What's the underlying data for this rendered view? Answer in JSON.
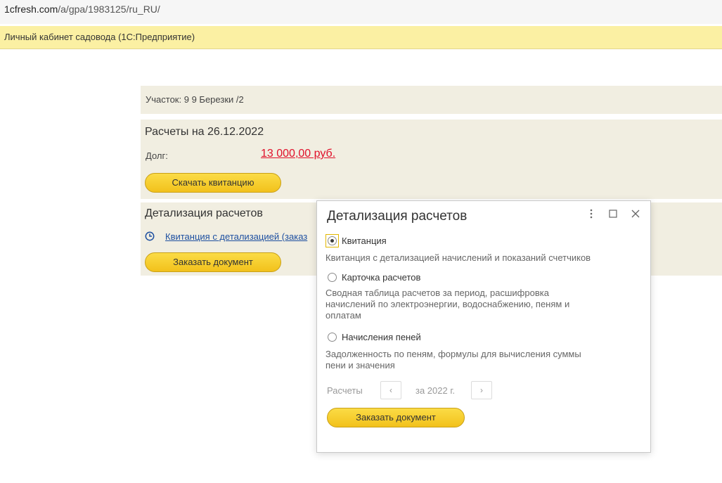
{
  "browser": {
    "url_host": "1cfresh.com",
    "url_path": "/a/gpa/1983125/ru_RU/"
  },
  "app": {
    "title": "Личный кабинет садовода  (1С:Предприятие)"
  },
  "plot": {
    "label": "Участок:",
    "value": "9 9 Березки /2"
  },
  "calculations": {
    "title": "Расчеты на 26.12.2022",
    "debt_label": "Долг:",
    "debt_value": "13 000,00 руб.",
    "download_button": "Скачать квитанцию"
  },
  "detail_section": {
    "title": "Детализация расчетов",
    "link_text": "Квитанция с детализацией (заказ",
    "order_button": "Заказать документ"
  },
  "dialog": {
    "title": "Детализация расчетов",
    "options": [
      {
        "label": "Квитанция",
        "description": "Квитанция с детализацией начислений и показаний счетчиков",
        "selected": true
      },
      {
        "label": "Карточка расчетов",
        "description": "Сводная таблица расчетов за период, расшифровка начислений по электроэнергии, водоснабжению, пеням и оплатам",
        "selected": false
      },
      {
        "label": "Начисления пеней",
        "description": "Задолженность по пеням, формулы для вычисления суммы пени и значения",
        "selected": false
      }
    ],
    "period_label": "Расчеты",
    "period_prev": "‹",
    "period_value": "за 2022 г.",
    "period_next": "›",
    "order_button": "Заказать документ"
  },
  "colors": {
    "accent_yellow": "#f6c928",
    "header_bg": "#fbf0a3",
    "panel_bg": "#f1eee1",
    "debt_red": "#e0102a",
    "link_blue": "#1d4fa0"
  },
  "icons": {
    "history": "clock-icon",
    "more": "more-vertical-icon",
    "maximize": "maximize-icon",
    "close": "close-icon"
  }
}
